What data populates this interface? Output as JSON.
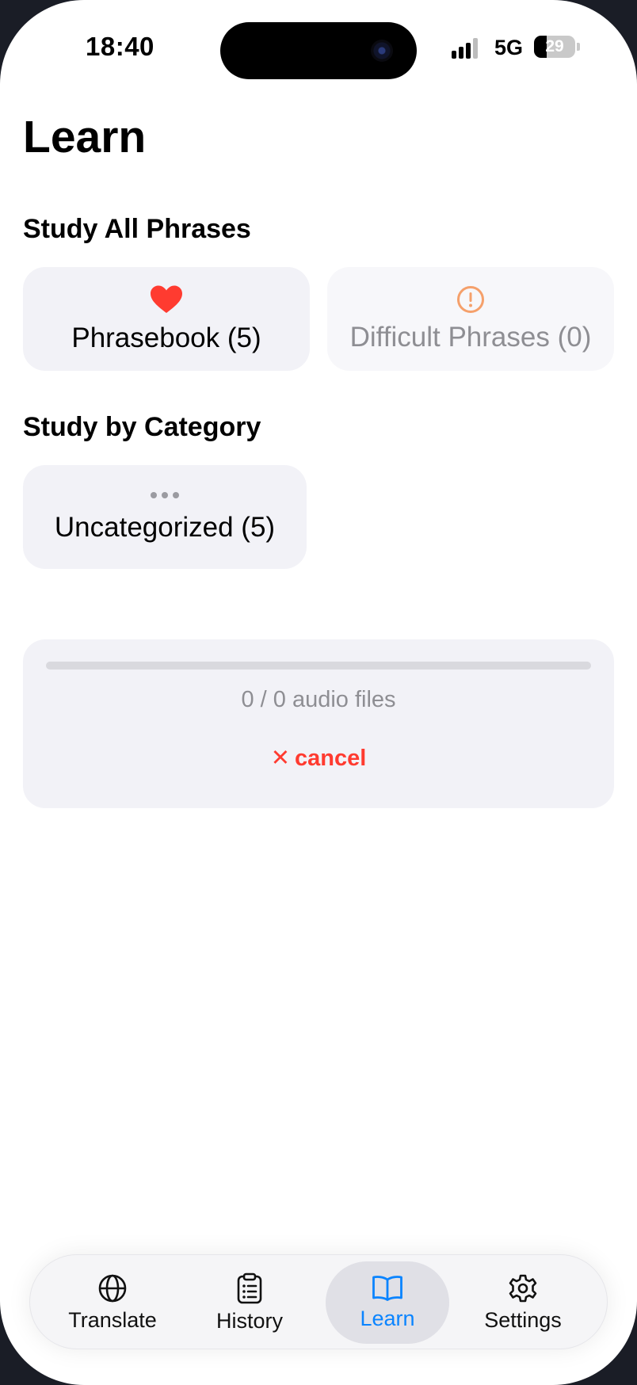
{
  "status_bar": {
    "time": "18:40",
    "network": "5G",
    "battery": "29"
  },
  "page": {
    "title": "Learn"
  },
  "study_all": {
    "title": "Study All Phrases",
    "phrasebook_label": "Phrasebook (5)",
    "phrasebook_icon": "heart-icon",
    "difficult_label": "Difficult Phrases (0)",
    "difficult_icon": "exclamation-circle-icon"
  },
  "study_category": {
    "title": "Study by Category",
    "items": [
      {
        "label": "Uncategorized (5)",
        "icon": "ellipsis-icon"
      }
    ]
  },
  "download": {
    "progress_fraction": 0,
    "status_text": "0 / 0 audio files",
    "cancel_label": "cancel"
  },
  "tabbar": {
    "tabs": [
      {
        "label": "Translate",
        "icon": "globe-icon",
        "active": false
      },
      {
        "label": "History",
        "icon": "clipboard-icon",
        "active": false
      },
      {
        "label": "Learn",
        "icon": "book-icon",
        "active": true
      },
      {
        "label": "Settings",
        "icon": "gear-icon",
        "active": false
      }
    ]
  },
  "colors": {
    "accent": "#0a84ff",
    "heart": "#ff3b30",
    "warning": "#f5a06b",
    "cancel": "#ff3b30"
  }
}
